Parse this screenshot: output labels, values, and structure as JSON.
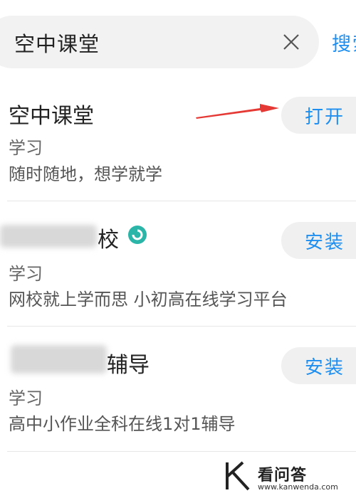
{
  "search": {
    "query": "空中课堂",
    "search_label": "搜索"
  },
  "results": [
    {
      "name": "空中课堂",
      "category": "学习",
      "description": "随时随地，想学就学",
      "action_label": "打开"
    },
    {
      "name_visible_suffix": "校",
      "category": "学习",
      "description": "网校就上学而思 小初高在线学习平台",
      "action_label": "安装"
    },
    {
      "name_visible_suffix": "辅导",
      "category": "学习",
      "description": "高中小作业全科在线1对1辅导",
      "action_label": "安装"
    }
  ],
  "watermark": {
    "text": "看问答",
    "url": "www.kanwenda.com"
  },
  "colors": {
    "accent": "#1e8ff0",
    "arrow": "#e53935",
    "button_bg": "#f0f0f0",
    "search_bg": "#f2f2f2"
  }
}
